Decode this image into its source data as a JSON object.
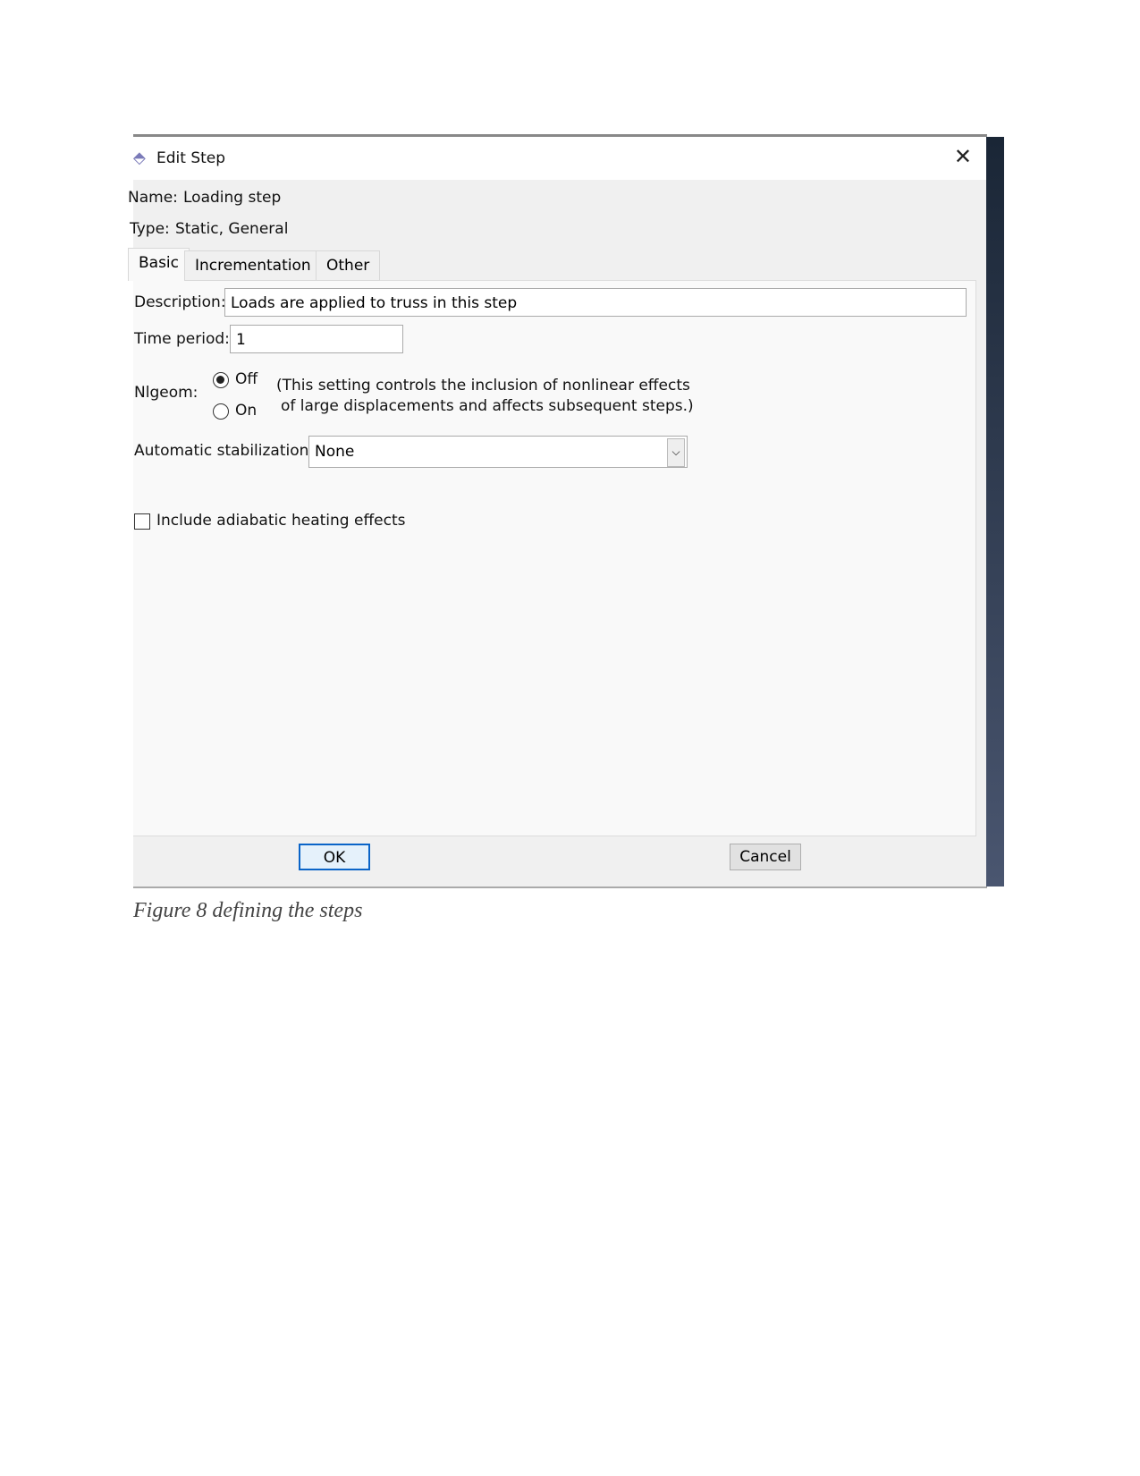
{
  "dialog": {
    "title": "Edit Step",
    "name_label": "Name:",
    "name_value": "Loading step",
    "type_label": "Type:",
    "type_value": "Static, General",
    "tabs": [
      {
        "label": "Basic"
      },
      {
        "label": "Incrementation"
      },
      {
        "label": "Other"
      }
    ],
    "description_label": "Description:",
    "description_value": "Loads are applied to truss in this step",
    "time_period_label": "Time period:",
    "time_period_value": "1",
    "nlgeom_label": "Nlgeom:",
    "nlgeom_options": [
      {
        "label": "Off",
        "selected": true
      },
      {
        "label": "On",
        "selected": false
      }
    ],
    "nlgeom_note_line1": "(This setting controls the inclusion of nonlinear effects",
    "nlgeom_note_line2": "of large displacements and affects subsequent steps.)",
    "stabilization_label": "Automatic stabilization:",
    "stabilization_value": "None",
    "adiabatic_label": "Include adiabatic heating effects",
    "adiabatic_checked": false,
    "ok_label": "OK",
    "cancel_label": "Cancel",
    "close_icon": "close-icon"
  },
  "caption": "Figure 8 defining the steps"
}
